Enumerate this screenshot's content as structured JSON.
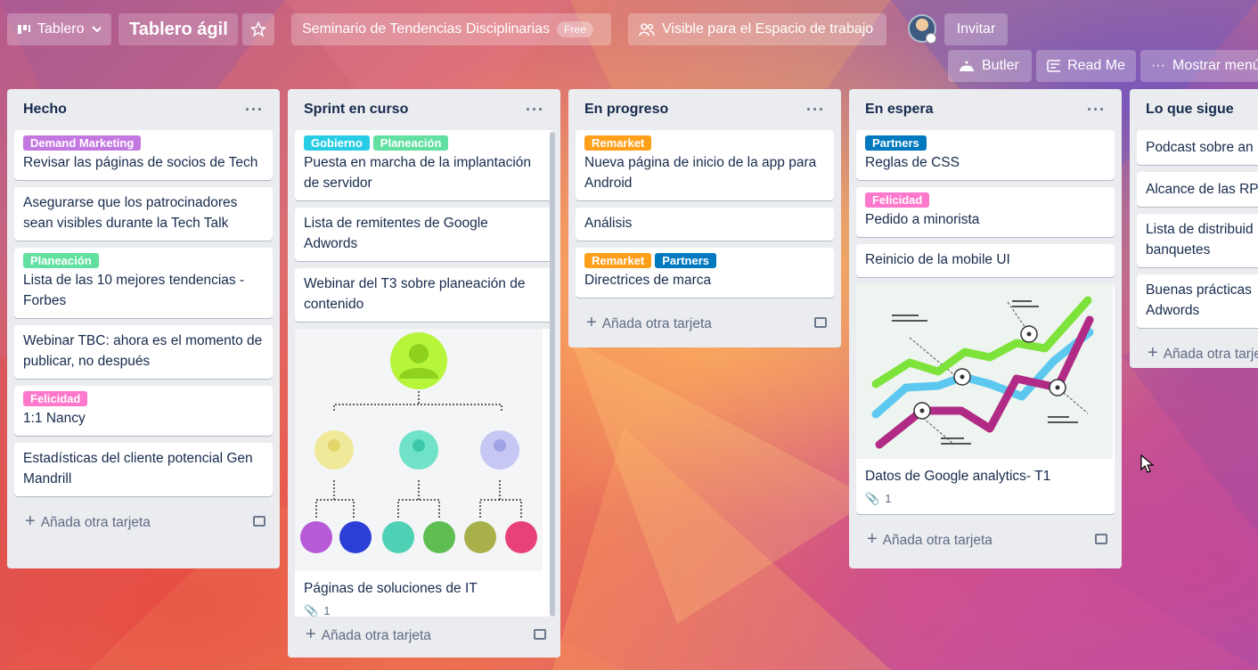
{
  "colors": {
    "purple": "#c377e0",
    "cyan": "#29cce5",
    "green": "#61e0a1",
    "orange": "#ff9f1a",
    "blue": "#0079bf",
    "pink": "#ff78cb"
  },
  "topbar": {
    "board_view": "Tablero",
    "board_title": "Tablero ágil",
    "workspace": "Seminario de Tendencias Disciplinarias",
    "workspace_badge": "Free",
    "visibility": "Visible para el Espacio de trabajo",
    "invite": "Invitar",
    "butler": "Butler",
    "readme": "Read Me",
    "show_menu": "Mostrar menú"
  },
  "add_card_label": "Añada otra tarjeta",
  "lists": [
    {
      "title": "Hecho",
      "cards": [
        {
          "labels": [
            {
              "text": "Demand Marketing",
              "color": "purple"
            }
          ],
          "text": "Revisar las páginas de socios de Tech"
        },
        {
          "labels": [],
          "text": "Asegurarse que los patrocinadores sean visibles durante la Tech Talk"
        },
        {
          "labels": [
            {
              "text": "Planeación",
              "color": "green"
            }
          ],
          "text": "Lista de las 10 mejores tendencias - Forbes"
        },
        {
          "labels": [],
          "text": "Webinar TBC: ahora es el momento de publicar, no después"
        },
        {
          "labels": [
            {
              "text": "Felicidad",
              "color": "pink"
            }
          ],
          "text": "1:1 Nancy"
        },
        {
          "labels": [],
          "text": "Estadísticas del cliente potencial Gen Mandrill"
        }
      ]
    },
    {
      "title": "Sprint en curso",
      "cards": [
        {
          "labels": [
            {
              "text": "Gobierno",
              "color": "cyan"
            },
            {
              "text": "Planeación",
              "color": "green"
            }
          ],
          "text": "Puesta en marcha de la implantación de servidor"
        },
        {
          "labels": [],
          "text": "Lista de remitentes de Google Adwords"
        },
        {
          "labels": [],
          "text": "Webinar del T3 sobre planeación de contenido"
        },
        {
          "labels": [],
          "text": "Páginas de soluciones de IT",
          "attachments": "1"
        }
      ]
    },
    {
      "title": "En progreso",
      "cards": [
        {
          "labels": [
            {
              "text": "Remarket",
              "color": "orange"
            }
          ],
          "text": "Nueva página de inicio de la app para Android"
        },
        {
          "labels": [],
          "text": "Análisis"
        },
        {
          "labels": [
            {
              "text": "Remarket",
              "color": "orange"
            },
            {
              "text": "Partners",
              "color": "blue"
            }
          ],
          "text": "Directrices de marca"
        }
      ]
    },
    {
      "title": "En espera",
      "cards": [
        {
          "labels": [
            {
              "text": "Partners",
              "color": "blue"
            }
          ],
          "text": "Reglas de CSS"
        },
        {
          "labels": [
            {
              "text": "Felicidad",
              "color": "pink"
            }
          ],
          "text": "Pedido a minorista"
        },
        {
          "labels": [],
          "text": "Reinicio de la mobile UI"
        },
        {
          "labels": [],
          "text": "Datos de Google analytics- T1",
          "attachments": "1"
        }
      ]
    },
    {
      "title": "Lo que sigue",
      "cards": [
        {
          "labels": [],
          "text": "Podcast sobre an"
        },
        {
          "labels": [],
          "text": "Alcance de las RP"
        },
        {
          "labels": [],
          "text": "Lista de distribuid banquetes"
        },
        {
          "labels": [],
          "text": "Buenas prácticas Adwords"
        }
      ]
    }
  ]
}
